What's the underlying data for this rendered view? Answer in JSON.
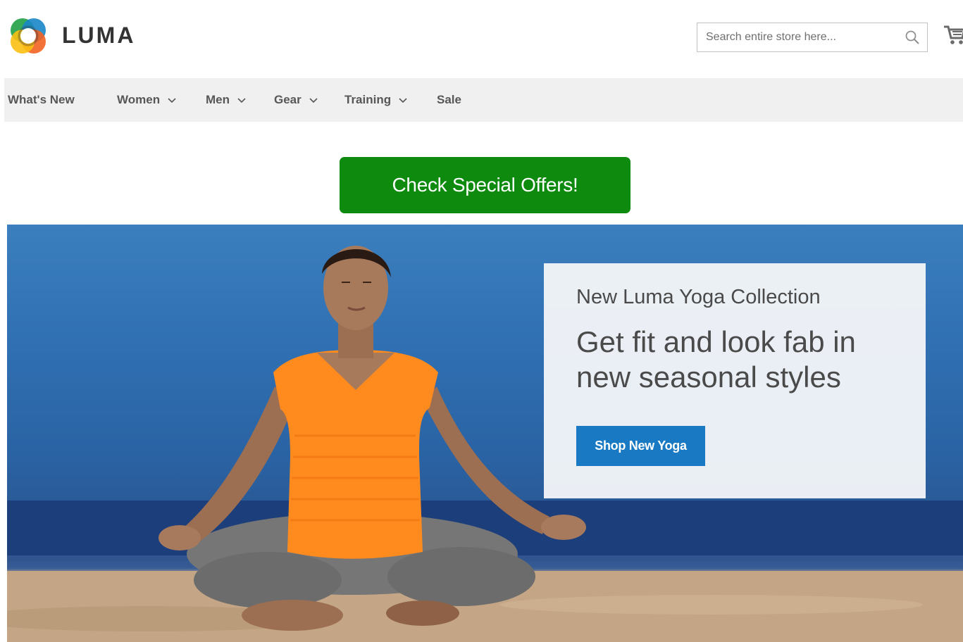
{
  "header": {
    "logo_text": "LUMA",
    "search": {
      "placeholder": "Search entire store here..."
    },
    "icons": {
      "search": "search-icon",
      "cart": "cart-icon",
      "logo": "luma-logo-icon"
    }
  },
  "nav": {
    "items": [
      {
        "label": "What's New",
        "has_dropdown": false
      },
      {
        "label": "Women",
        "has_dropdown": true
      },
      {
        "label": "Men",
        "has_dropdown": true
      },
      {
        "label": "Gear",
        "has_dropdown": true
      },
      {
        "label": "Training",
        "has_dropdown": true
      },
      {
        "label": "Sale",
        "has_dropdown": false
      }
    ]
  },
  "cta": {
    "label": "Check Special Offers!",
    "color": "#0e8a0f"
  },
  "hero": {
    "kicker": "New Luma Yoga Collection",
    "headline": "Get fit and look fab in new seasonal styles",
    "button_label": "Shop New Yoga",
    "button_color": "#1979c3"
  }
}
